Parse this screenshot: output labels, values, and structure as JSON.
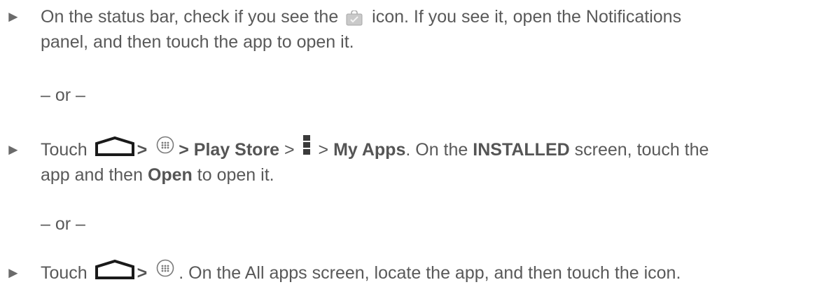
{
  "bullet_glyph": "►",
  "steps": [
    {
      "text_1": "On the status bar, check if you see the",
      "icon_1": "play-store-bag-icon",
      "text_2": "icon. If you see it, open the Notifications",
      "line_2": "panel, and then touch the app to open it."
    },
    {
      "text_1": "Touch",
      "icon_1": "home-icon",
      "gt_1": ">",
      "icon_2": "apps-launcher-icon",
      "gt_2": ">",
      "bold_1": "Play Store",
      "sep_1": ">",
      "icon_3": "menu-icon",
      "sep_2": ">",
      "bold_2": "My Apps",
      "text_2": ". On the",
      "bold_3": "INSTALLED",
      "text_3": "screen, touch the",
      "line_2_a": "app and then",
      "bold_4": "Open",
      "line_2_b": "to open it."
    },
    {
      "text_1": "Touch",
      "icon_1": "home-icon",
      "gt_1": ">",
      "icon_2": "apps-launcher-icon",
      "text_2": ". On the All apps screen, locate the app, and then touch the icon."
    }
  ],
  "separator": "– or –"
}
